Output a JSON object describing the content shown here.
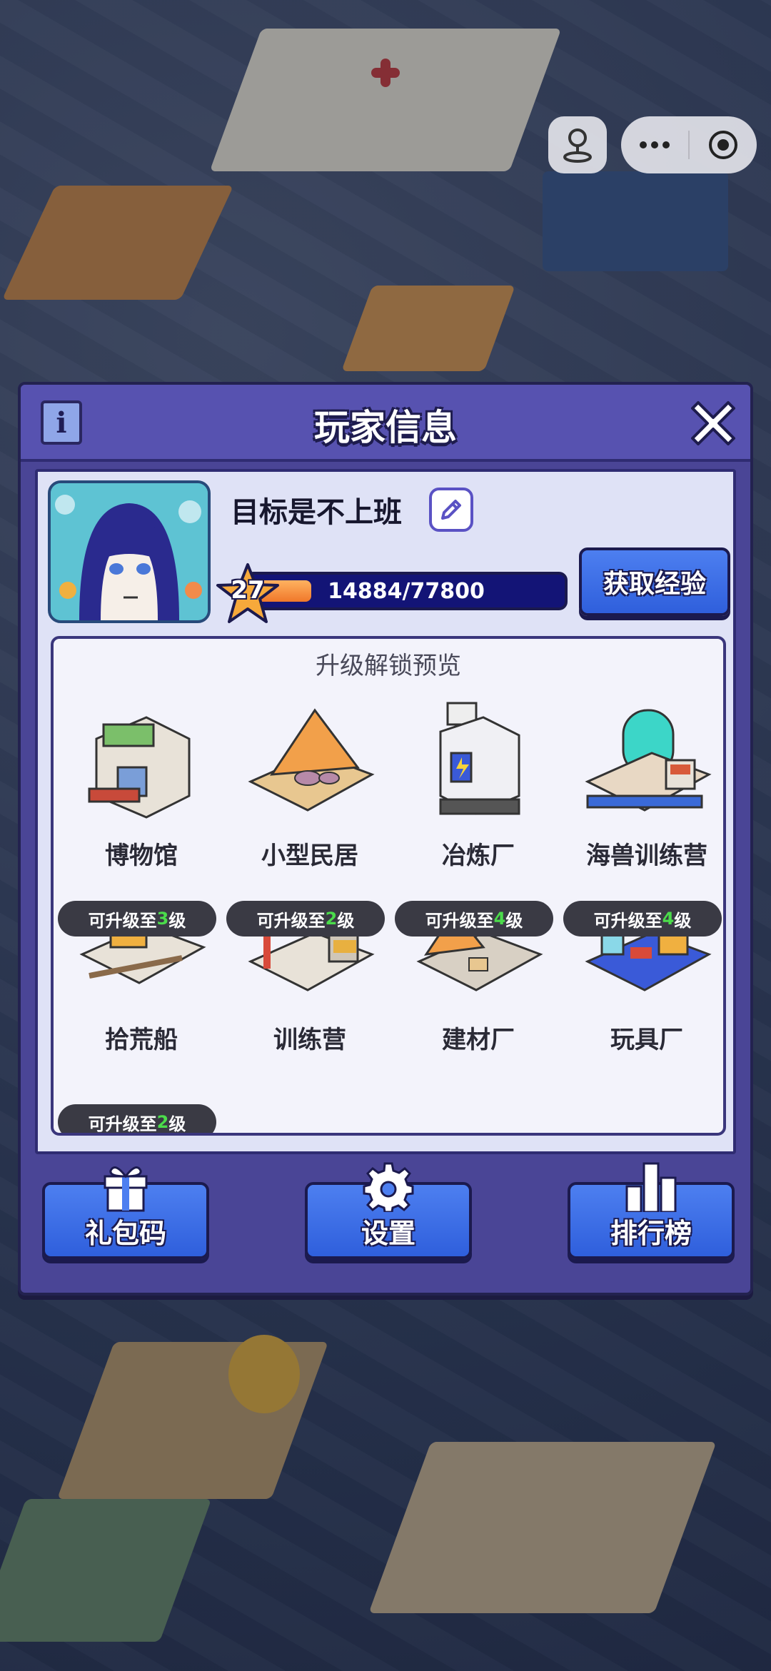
{
  "window": {
    "title": "玩家信息"
  },
  "colors": {
    "accent": "#4d7ff0",
    "header": "#5752b0",
    "exp_fill": "#f0782a",
    "unlock_level": "#4bdc4b"
  },
  "icons": {
    "info": "info-icon",
    "close": "close-icon",
    "edit": "pencil-icon",
    "joystick": "joystick-icon",
    "more": "more-icon",
    "record": "target-icon",
    "gift": "gift-icon",
    "settings": "gear-icon",
    "ranking": "bar-chart-icon"
  },
  "player": {
    "name": "目标是不上班",
    "level": "27",
    "exp_text": "14884/77800",
    "exp_fraction": 0.1913,
    "gain_exp_label": "获取经验"
  },
  "preview": {
    "title": "升级解锁预览",
    "buildings": [
      {
        "name": "博物馆",
        "badge": ""
      },
      {
        "name": "小型民居",
        "badge": ""
      },
      {
        "name": "冶炼厂",
        "badge": ""
      },
      {
        "name": "海兽训练营",
        "badge": ""
      },
      {
        "name": "拾荒船",
        "badge_pre": "可升级至",
        "badge_lv": "3",
        "badge_post": "级"
      },
      {
        "name": "训练营",
        "badge_pre": "可升级至",
        "badge_lv": "2",
        "badge_post": "级"
      },
      {
        "name": "建材厂",
        "badge_pre": "可升级至",
        "badge_lv": "4",
        "badge_post": "级"
      },
      {
        "name": "玩具厂",
        "badge_pre": "可升级至",
        "badge_lv": "4",
        "badge_post": "级"
      },
      {
        "badge_pre": "可升级至",
        "badge_lv": "2",
        "badge_post": "级"
      }
    ]
  },
  "buttons": {
    "gift_code": "礼包码",
    "settings": "设置",
    "ranking": "排行榜"
  }
}
